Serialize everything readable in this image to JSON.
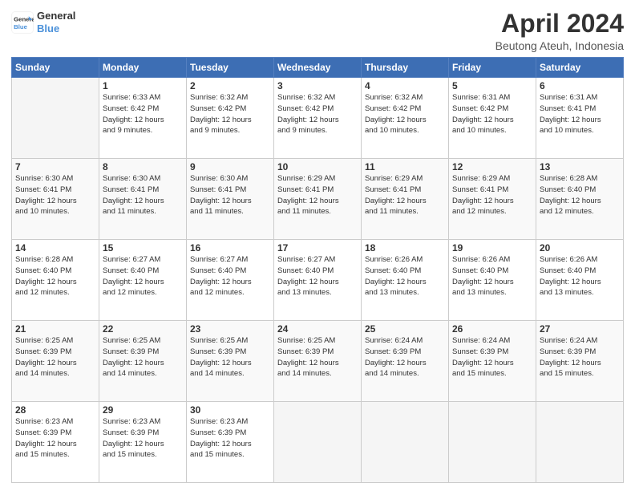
{
  "header": {
    "logo_line1": "General",
    "logo_line2": "Blue",
    "title": "April 2024",
    "subtitle": "Beutong Ateuh, Indonesia"
  },
  "days_of_week": [
    "Sunday",
    "Monday",
    "Tuesday",
    "Wednesday",
    "Thursday",
    "Friday",
    "Saturday"
  ],
  "weeks": [
    [
      {
        "day": "",
        "info": ""
      },
      {
        "day": "1",
        "info": "Sunrise: 6:33 AM\nSunset: 6:42 PM\nDaylight: 12 hours\nand 9 minutes."
      },
      {
        "day": "2",
        "info": "Sunrise: 6:32 AM\nSunset: 6:42 PM\nDaylight: 12 hours\nand 9 minutes."
      },
      {
        "day": "3",
        "info": "Sunrise: 6:32 AM\nSunset: 6:42 PM\nDaylight: 12 hours\nand 9 minutes."
      },
      {
        "day": "4",
        "info": "Sunrise: 6:32 AM\nSunset: 6:42 PM\nDaylight: 12 hours\nand 10 minutes."
      },
      {
        "day": "5",
        "info": "Sunrise: 6:31 AM\nSunset: 6:42 PM\nDaylight: 12 hours\nand 10 minutes."
      },
      {
        "day": "6",
        "info": "Sunrise: 6:31 AM\nSunset: 6:41 PM\nDaylight: 12 hours\nand 10 minutes."
      }
    ],
    [
      {
        "day": "7",
        "info": "Sunrise: 6:30 AM\nSunset: 6:41 PM\nDaylight: 12 hours\nand 10 minutes."
      },
      {
        "day": "8",
        "info": "Sunrise: 6:30 AM\nSunset: 6:41 PM\nDaylight: 12 hours\nand 11 minutes."
      },
      {
        "day": "9",
        "info": "Sunrise: 6:30 AM\nSunset: 6:41 PM\nDaylight: 12 hours\nand 11 minutes."
      },
      {
        "day": "10",
        "info": "Sunrise: 6:29 AM\nSunset: 6:41 PM\nDaylight: 12 hours\nand 11 minutes."
      },
      {
        "day": "11",
        "info": "Sunrise: 6:29 AM\nSunset: 6:41 PM\nDaylight: 12 hours\nand 11 minutes."
      },
      {
        "day": "12",
        "info": "Sunrise: 6:29 AM\nSunset: 6:41 PM\nDaylight: 12 hours\nand 12 minutes."
      },
      {
        "day": "13",
        "info": "Sunrise: 6:28 AM\nSunset: 6:40 PM\nDaylight: 12 hours\nand 12 minutes."
      }
    ],
    [
      {
        "day": "14",
        "info": "Sunrise: 6:28 AM\nSunset: 6:40 PM\nDaylight: 12 hours\nand 12 minutes."
      },
      {
        "day": "15",
        "info": "Sunrise: 6:27 AM\nSunset: 6:40 PM\nDaylight: 12 hours\nand 12 minutes."
      },
      {
        "day": "16",
        "info": "Sunrise: 6:27 AM\nSunset: 6:40 PM\nDaylight: 12 hours\nand 12 minutes."
      },
      {
        "day": "17",
        "info": "Sunrise: 6:27 AM\nSunset: 6:40 PM\nDaylight: 12 hours\nand 13 minutes."
      },
      {
        "day": "18",
        "info": "Sunrise: 6:26 AM\nSunset: 6:40 PM\nDaylight: 12 hours\nand 13 minutes."
      },
      {
        "day": "19",
        "info": "Sunrise: 6:26 AM\nSunset: 6:40 PM\nDaylight: 12 hours\nand 13 minutes."
      },
      {
        "day": "20",
        "info": "Sunrise: 6:26 AM\nSunset: 6:40 PM\nDaylight: 12 hours\nand 13 minutes."
      }
    ],
    [
      {
        "day": "21",
        "info": "Sunrise: 6:25 AM\nSunset: 6:39 PM\nDaylight: 12 hours\nand 14 minutes."
      },
      {
        "day": "22",
        "info": "Sunrise: 6:25 AM\nSunset: 6:39 PM\nDaylight: 12 hours\nand 14 minutes."
      },
      {
        "day": "23",
        "info": "Sunrise: 6:25 AM\nSunset: 6:39 PM\nDaylight: 12 hours\nand 14 minutes."
      },
      {
        "day": "24",
        "info": "Sunrise: 6:25 AM\nSunset: 6:39 PM\nDaylight: 12 hours\nand 14 minutes."
      },
      {
        "day": "25",
        "info": "Sunrise: 6:24 AM\nSunset: 6:39 PM\nDaylight: 12 hours\nand 14 minutes."
      },
      {
        "day": "26",
        "info": "Sunrise: 6:24 AM\nSunset: 6:39 PM\nDaylight: 12 hours\nand 15 minutes."
      },
      {
        "day": "27",
        "info": "Sunrise: 6:24 AM\nSunset: 6:39 PM\nDaylight: 12 hours\nand 15 minutes."
      }
    ],
    [
      {
        "day": "28",
        "info": "Sunrise: 6:23 AM\nSunset: 6:39 PM\nDaylight: 12 hours\nand 15 minutes."
      },
      {
        "day": "29",
        "info": "Sunrise: 6:23 AM\nSunset: 6:39 PM\nDaylight: 12 hours\nand 15 minutes."
      },
      {
        "day": "30",
        "info": "Sunrise: 6:23 AM\nSunset: 6:39 PM\nDaylight: 12 hours\nand 15 minutes."
      },
      {
        "day": "",
        "info": ""
      },
      {
        "day": "",
        "info": ""
      },
      {
        "day": "",
        "info": ""
      },
      {
        "day": "",
        "info": ""
      }
    ]
  ]
}
